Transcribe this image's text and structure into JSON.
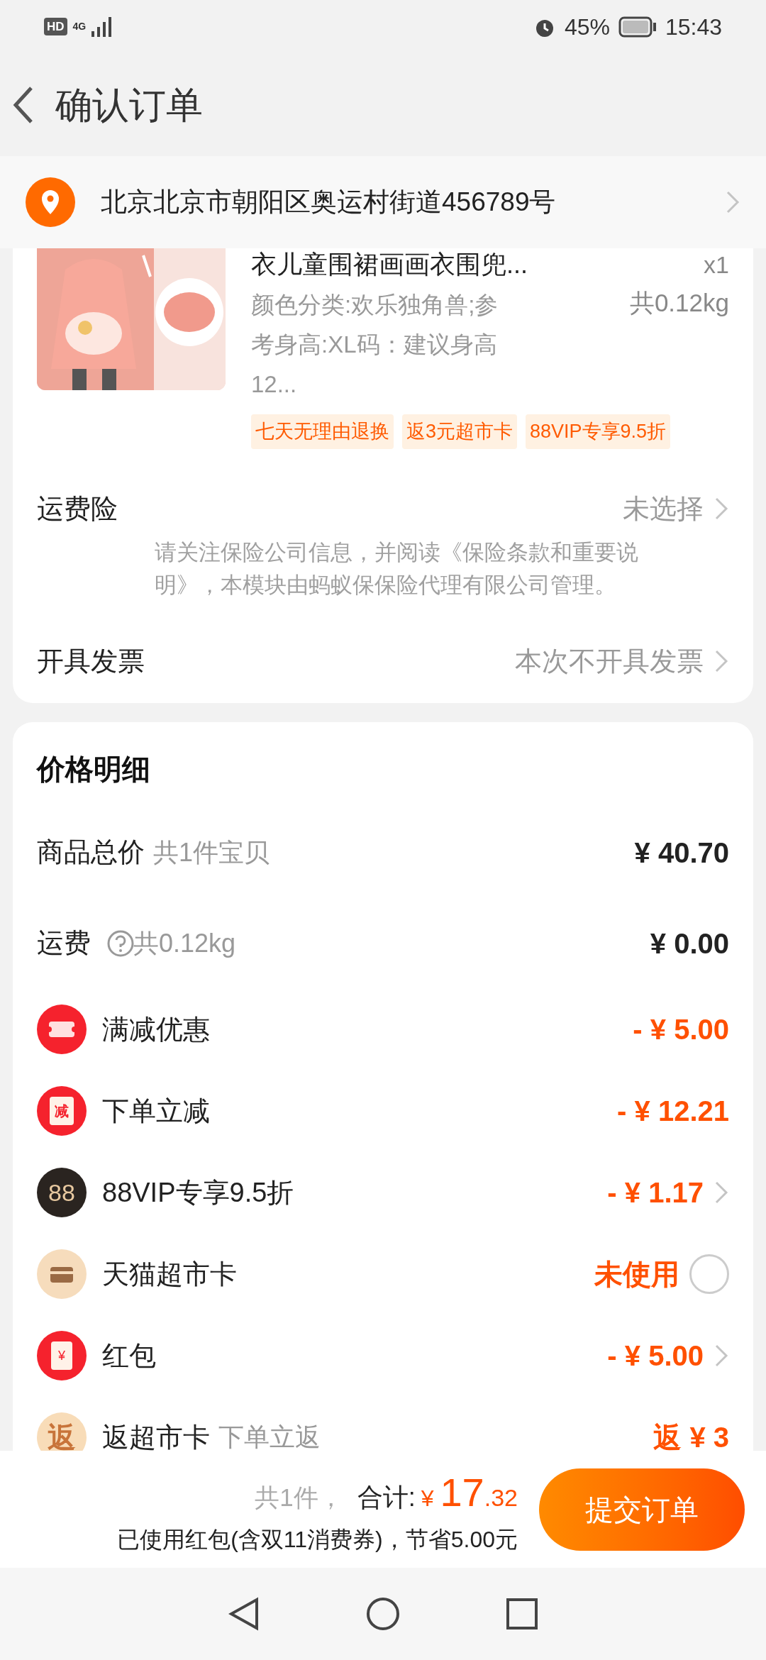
{
  "status_bar": {
    "hd": "HD",
    "network": "4G",
    "battery": "45%",
    "time": "15:43"
  },
  "header": {
    "title": "确认订单"
  },
  "address": {
    "text": "北京北京市朝阳区奥运村街道456789号"
  },
  "product": {
    "title": "衣儿童围裙画画衣围兜...",
    "spec": "颜色分类:欢乐独角兽;参考身高:XL码：建议身高12...",
    "quantity": "x1",
    "weight": "共0.12kg",
    "tags": [
      "七天无理由退换",
      "返3元超市卡",
      "88VIP专享9.5折"
    ]
  },
  "options": [
    {
      "label": "运费险",
      "value": "未选择",
      "note": "请关注保险公司信息，并阅读《保险条款和重要说明》，本模块由蚂蚁保保险代理有限公司管理。"
    },
    {
      "label": "开具发票",
      "value": "本次不开具发票"
    }
  ],
  "price_detail": {
    "title": "价格明细",
    "rows": [
      {
        "kind": "plain",
        "label": "商品总价",
        "sub": "共1件宝贝",
        "amount": "¥ 40.70",
        "highlight": false,
        "chevron": false
      },
      {
        "kind": "help",
        "label": "运费",
        "sub": "共0.12kg",
        "amount": "¥ 0.00",
        "highlight": false,
        "chevron": false
      },
      {
        "kind": "ticket",
        "label": "满减优惠",
        "amount": "- ¥ 5.00",
        "highlight": true,
        "chevron": false
      },
      {
        "kind": "badge",
        "badge": "减",
        "label": "下单立减",
        "amount": "- ¥ 12.21",
        "highlight": true,
        "chevron": false
      },
      {
        "kind": "vip",
        "badge": "88",
        "label": "88VIP专享9.5折",
        "amount": "- ¥ 1.17",
        "highlight": true,
        "chevron": true
      },
      {
        "kind": "card",
        "label": "天猫超市卡",
        "amount": "未使用",
        "highlight": true,
        "chevron": false,
        "checked": false
      },
      {
        "kind": "packet",
        "badge": "¥",
        "label": "红包",
        "amount": "- ¥ 5.00",
        "highlight": true,
        "chevron": true
      },
      {
        "kind": "gold",
        "badge": "返",
        "label": "返超市卡",
        "sub": "下单立返",
        "amount": "返 ¥ 3",
        "highlight": true,
        "chevron": false
      }
    ]
  },
  "footer": {
    "count": "共1件，",
    "total_label": "合计:",
    "currency": "¥",
    "total_int": "17",
    "total_dec": ".32",
    "savings": "已使用红包(含双11消费券)，节省5.00元",
    "submit": "提交订单"
  }
}
